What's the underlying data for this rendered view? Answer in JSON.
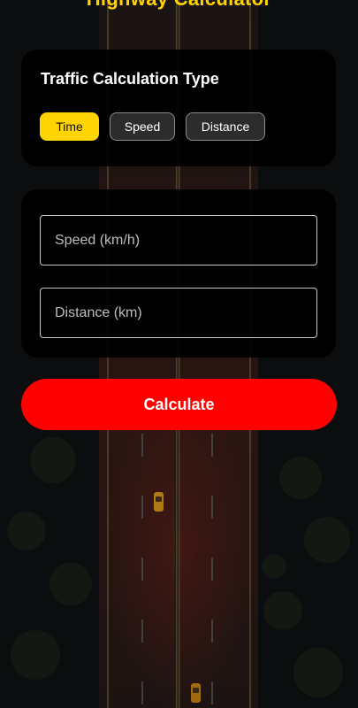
{
  "header": {
    "title": "Highway Calculator"
  },
  "calc_type": {
    "title": "Traffic Calculation Type",
    "options": [
      {
        "label": "Time",
        "selected": true
      },
      {
        "label": "Speed",
        "selected": false
      },
      {
        "label": "Distance",
        "selected": false
      }
    ]
  },
  "inputs": {
    "speed": {
      "placeholder": "Speed (km/h)",
      "value": ""
    },
    "distance": {
      "placeholder": "Distance (km)",
      "value": ""
    }
  },
  "actions": {
    "calculate_label": "Calculate"
  },
  "colors": {
    "accent_yellow": "#ffd400",
    "action_red": "#ff0000",
    "card_bg": "#000000",
    "background": "#0b0c0d"
  }
}
